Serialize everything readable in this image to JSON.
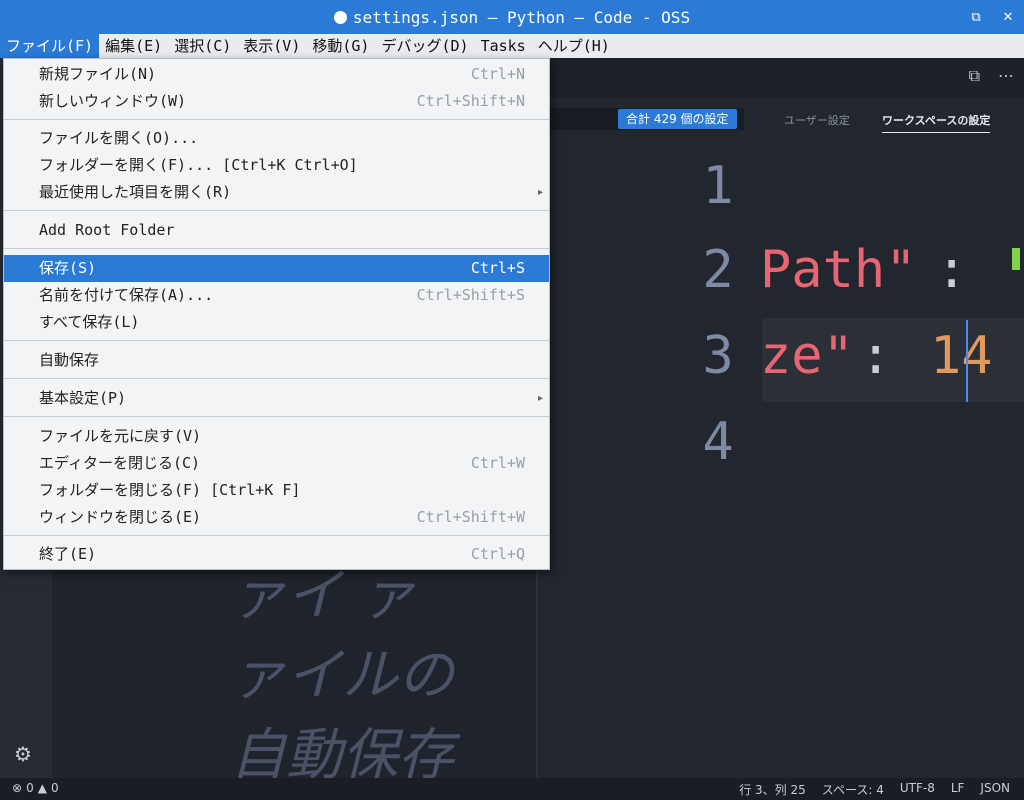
{
  "window": {
    "title": "settings.json — Python — Code - OSS",
    "controls": [
      "⧉",
      "✕"
    ]
  },
  "menubar": [
    {
      "label": "ファイル(F)",
      "active": true
    },
    {
      "label": "編集(E)"
    },
    {
      "label": "選択(C)"
    },
    {
      "label": "表示(V)"
    },
    {
      "label": "移動(G)"
    },
    {
      "label": "デバッグ(D)"
    },
    {
      "label": "Tasks"
    },
    {
      "label": "ヘルプ(H)"
    }
  ],
  "file_menu": {
    "items": [
      {
        "label": "新規ファイル(N)",
        "shortcut": "Ctrl+N"
      },
      {
        "label": "新しいウィンドウ(W)",
        "shortcut": "Ctrl+Shift+N"
      },
      {
        "label": "ファイルを開く(O)...",
        "shortcut": ""
      },
      {
        "label": "フォルダーを開く(F)... [Ctrl+K Ctrl+O]",
        "shortcut": ""
      },
      {
        "label": "最近使用した項目を開く(R)",
        "shortcut": "",
        "submenu": true
      },
      {
        "label": "Add Root Folder",
        "shortcut": ""
      },
      {
        "label": "保存(S)",
        "shortcut": "Ctrl+S",
        "highlighted": true
      },
      {
        "label": "名前を付けて保存(A)...",
        "shortcut": "Ctrl+Shift+S"
      },
      {
        "label": "すべて保存(L)",
        "shortcut": ""
      },
      {
        "label": "自動保存",
        "shortcut": ""
      },
      {
        "label": "基本設定(P)",
        "shortcut": "",
        "submenu": true
      },
      {
        "label": "ファイルを元に戻す(V)",
        "shortcut": ""
      },
      {
        "label": "エディターを閉じる(C)",
        "shortcut": "Ctrl+W"
      },
      {
        "label": "フォルダーを閉じる(F) [Ctrl+K F]",
        "shortcut": ""
      },
      {
        "label": "ウィンドウを閉じる(E)",
        "shortcut": "Ctrl+Shift+W"
      },
      {
        "label": "終了(E)",
        "shortcut": "Ctrl+Q"
      }
    ]
  },
  "settings": {
    "count_badge": "合計 429 個の設定",
    "user_tab": "ユーザー設定",
    "workspace_tab": "ワークスペースの設定"
  },
  "editor": {
    "line_numbers": [
      "1",
      "2",
      "3",
      "4"
    ],
    "line2_key": "Path\"",
    "line2_colon": ":",
    "line3_key": "ze\"",
    "line3_colon": ":",
    "line3_value": "14",
    "colors": {
      "key": "#e86671",
      "number": "#e2995e",
      "punct": "#c9ced6"
    }
  },
  "overlay_text": [
    "ァイ ァ",
    "ァイルの",
    "自動保存"
  ],
  "statusbar": {
    "errors": "0",
    "warnings": "0",
    "position": "行 3、列 25",
    "spaces": "スペース: 4",
    "encoding": "UTF-8",
    "eol": "LF",
    "language": "JSON"
  }
}
